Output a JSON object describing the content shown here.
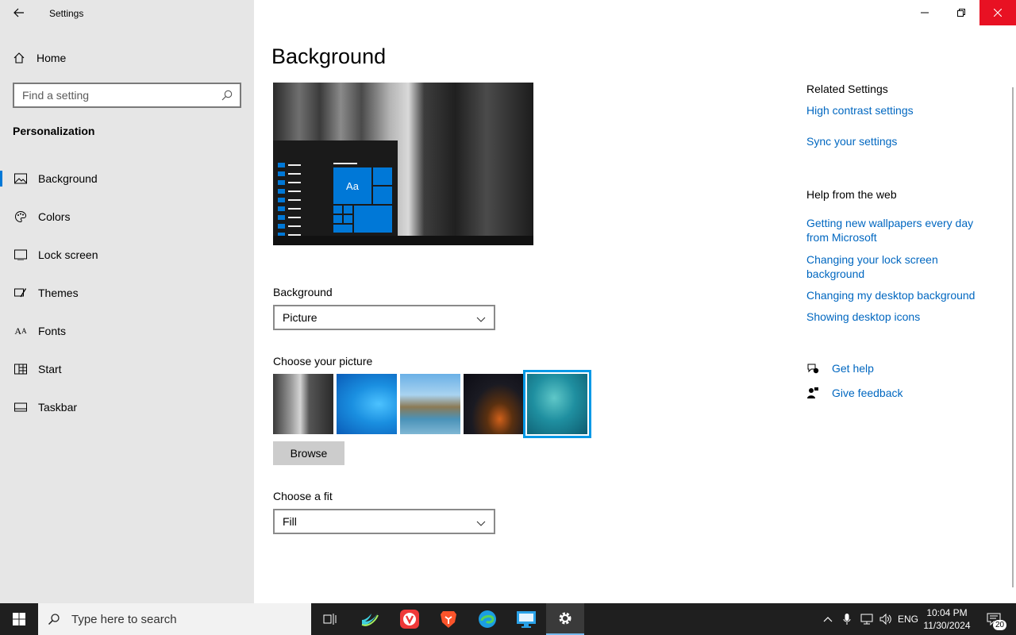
{
  "window": {
    "app_title": "Settings"
  },
  "sidebar": {
    "home_label": "Home",
    "search_placeholder": "Find a setting",
    "section_title": "Personalization",
    "items": [
      {
        "label": "Background",
        "icon": "picture-icon",
        "active": true
      },
      {
        "label": "Colors",
        "icon": "palette-icon",
        "active": false
      },
      {
        "label": "Lock screen",
        "icon": "lock-screen-icon",
        "active": false
      },
      {
        "label": "Themes",
        "icon": "brush-icon",
        "active": false
      },
      {
        "label": "Fonts",
        "icon": "font-icon",
        "active": false
      },
      {
        "label": "Start",
        "icon": "start-icon",
        "active": false
      },
      {
        "label": "Taskbar",
        "icon": "taskbar-icon",
        "active": false
      }
    ]
  },
  "main": {
    "title": "Background",
    "preview_tile_text": "Aa",
    "background_label": "Background",
    "background_value": "Picture",
    "choose_picture_label": "Choose your picture",
    "browse_label": "Browse",
    "fit_label": "Choose a fit",
    "fit_value": "Fill",
    "selected_picture_index": 4
  },
  "related": {
    "heading": "Related Settings",
    "links": [
      "High contrast settings",
      "Sync your settings"
    ]
  },
  "help_web": {
    "heading": "Help from the web",
    "links": [
      "Getting new wallpapers every day from Microsoft",
      "Changing your lock screen background",
      "Changing my desktop background",
      "Showing desktop icons"
    ]
  },
  "support": {
    "get_help": "Get help",
    "give_feedback": "Give feedback"
  },
  "taskbar": {
    "search_placeholder": "Type here to search",
    "language": "ENG",
    "time": "10:04 PM",
    "date": "11/30/2024",
    "notification_count": "20"
  },
  "colors": {
    "accent": "#0078d7",
    "link": "#0067c0",
    "close_red": "#e81123",
    "sidebar_bg": "#e6e6e6"
  }
}
